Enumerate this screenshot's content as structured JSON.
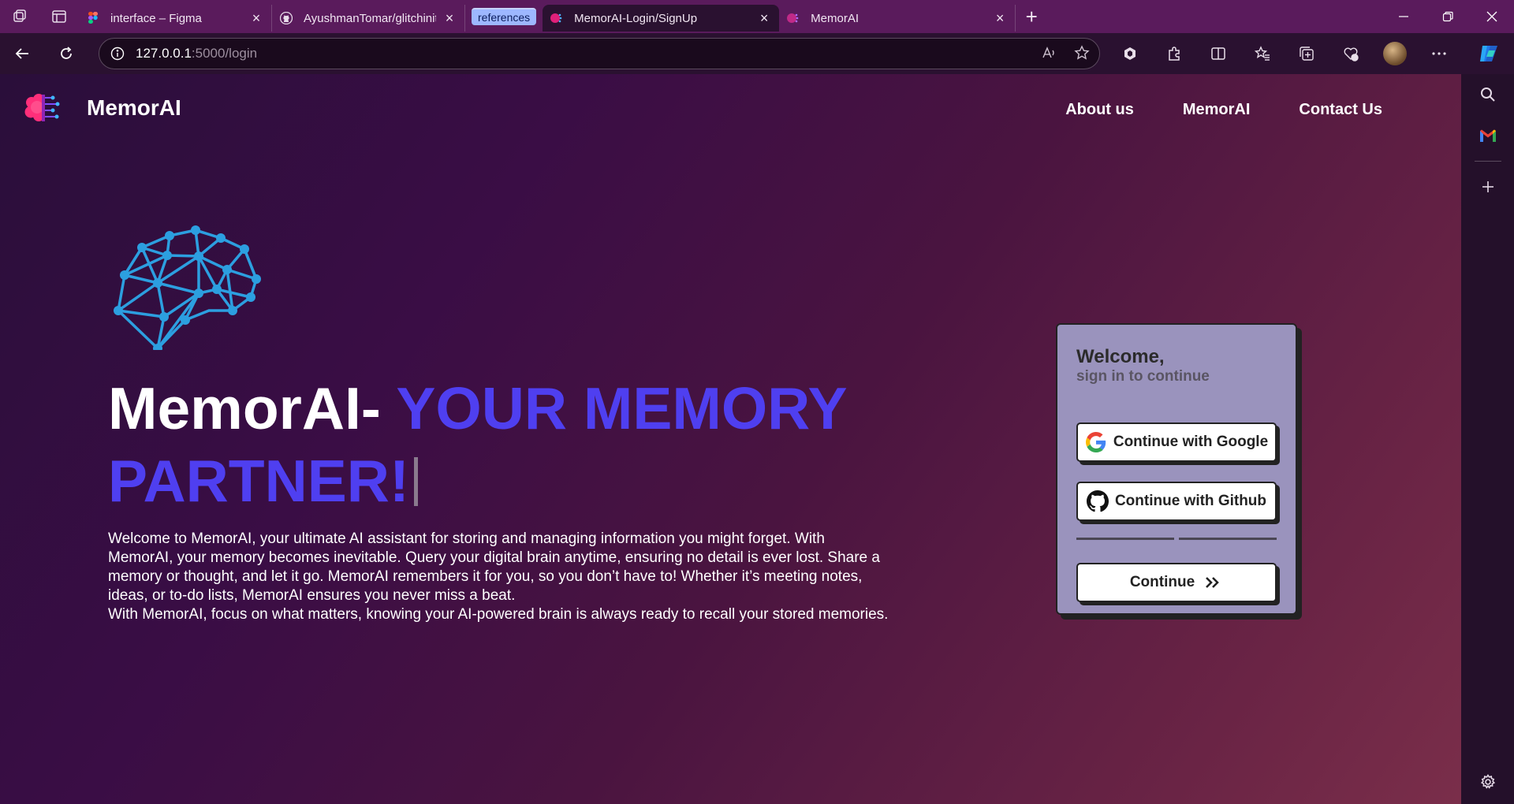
{
  "browser": {
    "tabs": [
      {
        "title": "interface – Figma",
        "favicon": "figma-icon"
      },
      {
        "title": "AyushmanTomar/glitchinity-Devja",
        "favicon": "github-icon"
      },
      {
        "title": "MemorAI-Login/SignUp",
        "favicon": "memorai-icon",
        "active": true
      },
      {
        "title": "MemorAI",
        "favicon": "memorai-icon"
      }
    ],
    "tab_group_label": "references",
    "url_host": "127.0.0.1",
    "url_rest": ":5000/login",
    "colors": {
      "tabstrip": "#5a1b5c",
      "toolbar": "#2a1130"
    }
  },
  "site": {
    "brand": "MemorAI",
    "nav": [
      "About us",
      "MemorAI",
      "Contact Us"
    ],
    "hero": {
      "title_plain": "MemorAI-",
      "title_accent_1": "YOUR MEMORY",
      "title_accent_2": "PARTNER!",
      "accent_color": "#4f3ff0",
      "paragraph_1": "Welcome to MemorAI, your ultimate AI assistant for storing and managing information you might forget. With MemorAI, your memory becomes inevitable. Query your digital brain anytime, ensuring no detail is ever lost. Share a memory or thought, and let it go. MemorAI remembers it for you, so you don’t have to! Whether it’s meeting notes, ideas, or to-do lists, MemorAI ensures you never miss a beat.",
      "paragraph_2": "With MemorAI, focus on what matters, knowing your AI-powered brain is always ready to recall your stored memories."
    },
    "login_card": {
      "heading": "Welcome,",
      "subheading": "sign in to continue",
      "google_label": "Continue with Google",
      "github_label": "Continue with Github",
      "continue_label": "Continue",
      "card_color": "#9a93bd"
    }
  }
}
